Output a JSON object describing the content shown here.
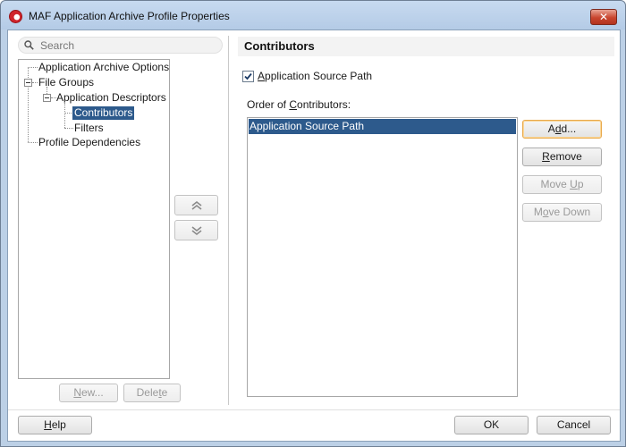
{
  "window": {
    "title": "MAF Application Archive Profile Properties",
    "close_glyph": "✕"
  },
  "search": {
    "placeholder": "Search"
  },
  "tree": {
    "items": [
      {
        "label": "Application Archive Options"
      },
      {
        "label": "File Groups"
      },
      {
        "label": "Application Descriptors"
      },
      {
        "label": "Contributors",
        "selected": true
      },
      {
        "label": "Filters"
      },
      {
        "label": "Profile Dependencies"
      }
    ],
    "new_label_u": "N",
    "new_label_rest": "ew...",
    "delete_label_pre": "Dele",
    "delete_label_u": "t",
    "delete_label_post": "e"
  },
  "main": {
    "title": "Contributors",
    "checkbox": {
      "label_u": "A",
      "label_rest": "pplication Source Path",
      "checked": true
    },
    "order_label_pre": "Order of ",
    "order_label_u": "C",
    "order_label_post": "ontributors:",
    "contributors": [
      "Application Source Path"
    ],
    "buttons": {
      "add_pre": "A",
      "add_u": "d",
      "add_post": "d...",
      "remove_u": "R",
      "remove_rest": "emove",
      "move_up_pre": "Move ",
      "move_up_u": "U",
      "move_up_post": "p",
      "move_down_pre": "M",
      "move_down_u": "o",
      "move_down_post": "ve Down"
    }
  },
  "footer": {
    "help_u": "H",
    "help_rest": "elp",
    "ok": "OK",
    "cancel": "Cancel"
  },
  "colors": {
    "selection": "#2d5a8c",
    "titlebar": "#b9cfe8",
    "close": "#c9462f",
    "focus_border": "#e8a84a"
  }
}
